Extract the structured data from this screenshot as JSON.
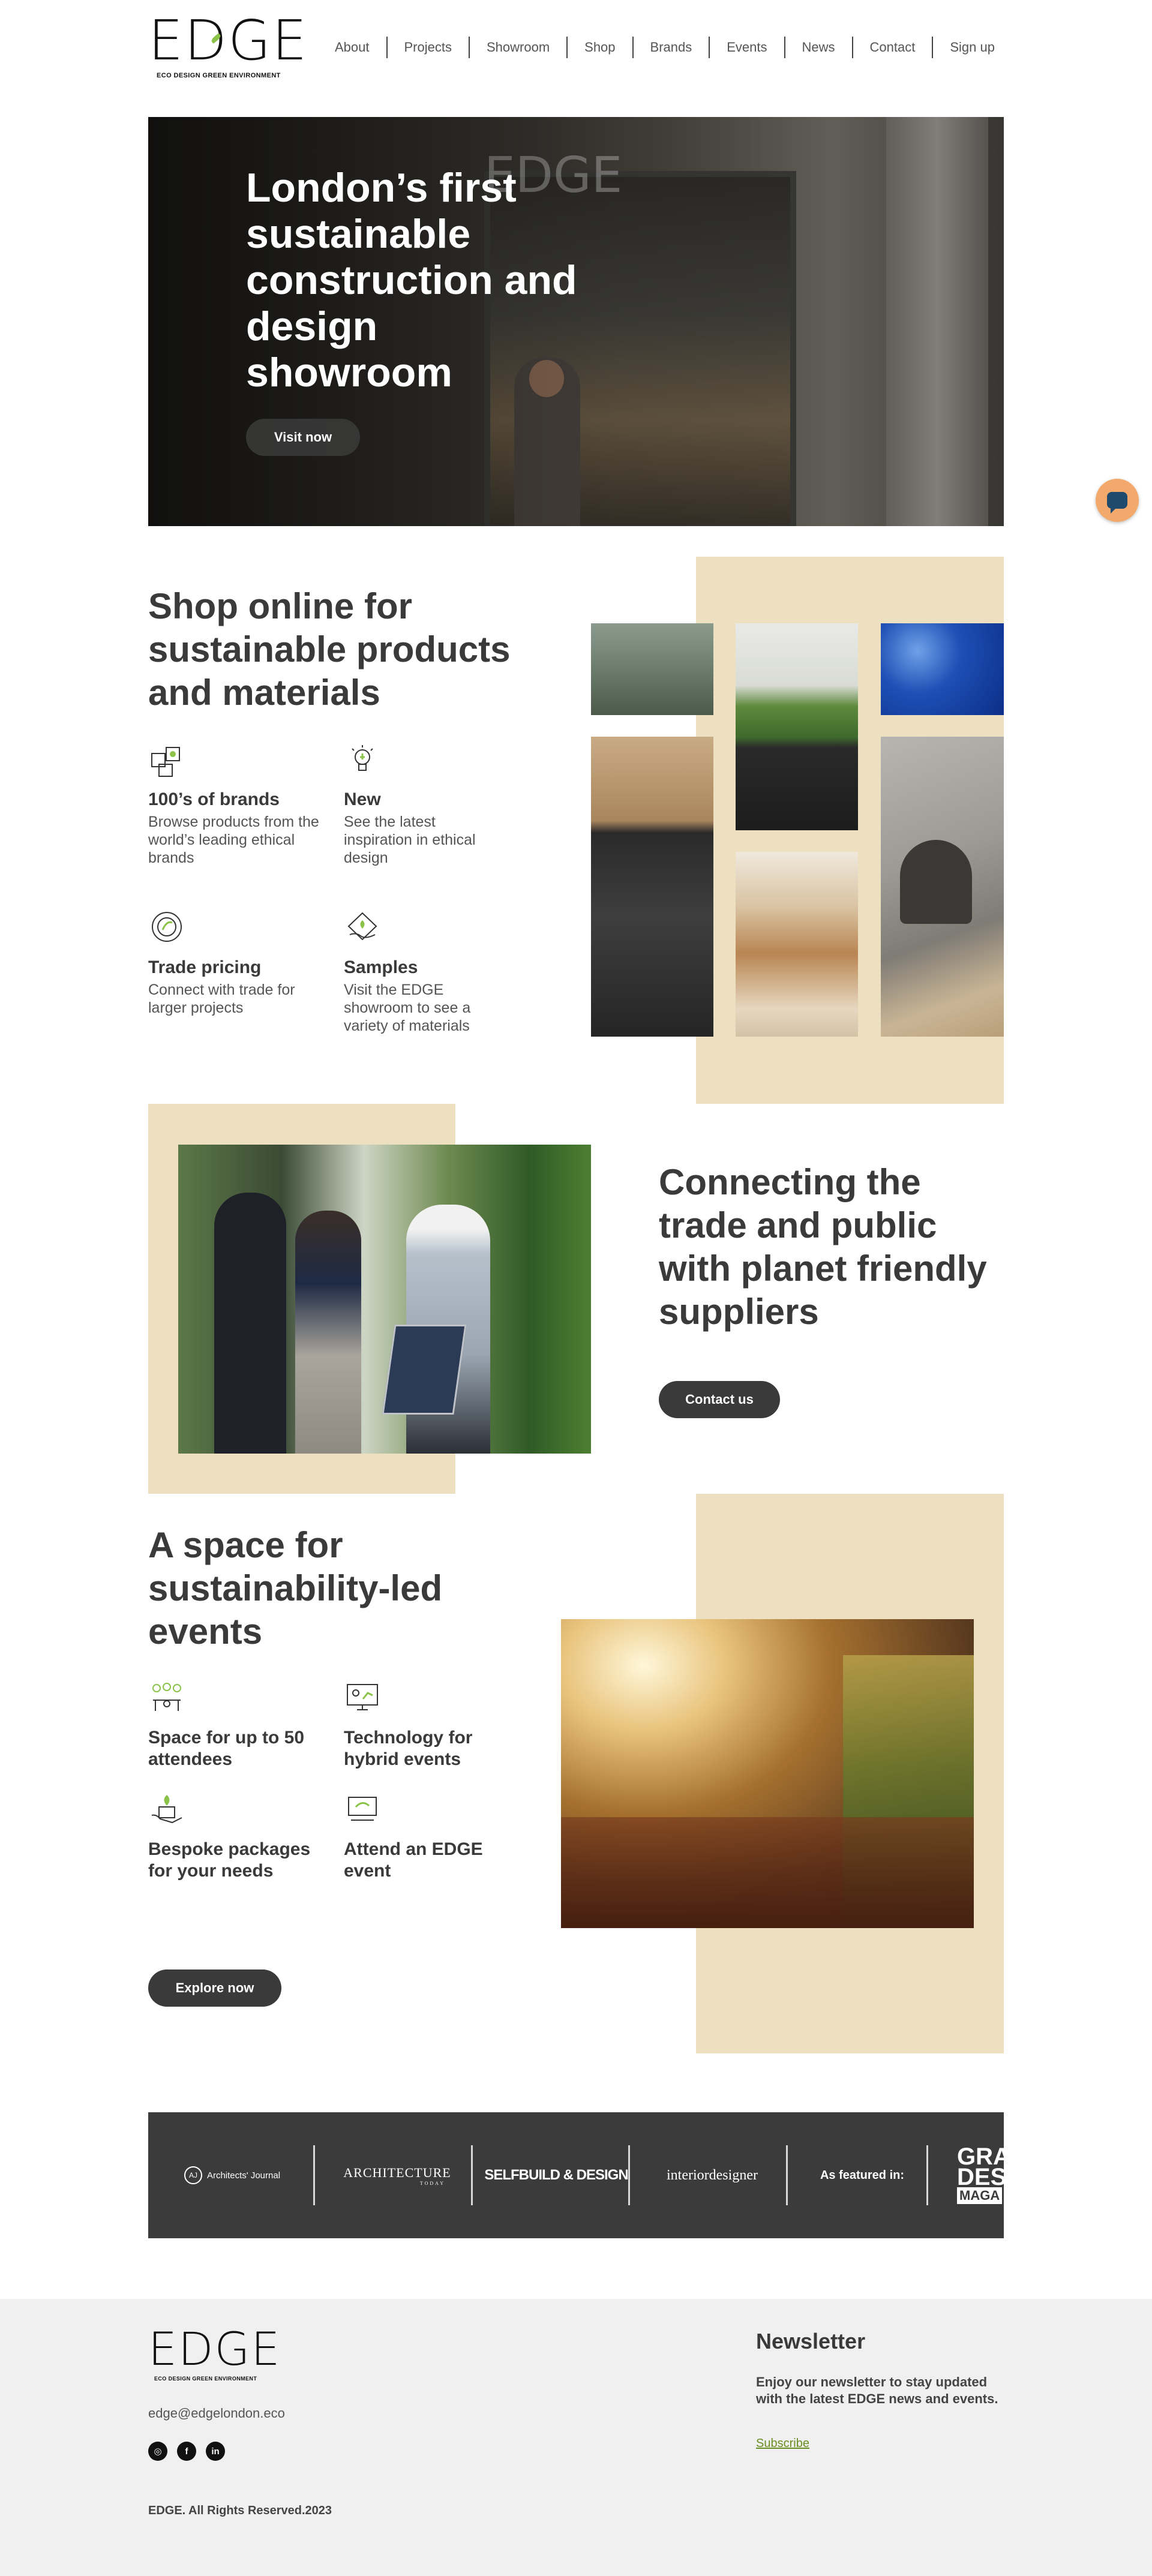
{
  "header": {
    "logo_text": "EDGE",
    "logo_tagline": "ECO DESIGN GREEN ENVIRONMENT",
    "nav": [
      "About",
      "Projects",
      "Showroom",
      "Shop",
      "Brands",
      "Events",
      "News",
      "Contact",
      "Sign up"
    ]
  },
  "hero": {
    "title": "London’s first sustainable construction and design showroom",
    "button": "Visit now"
  },
  "shop": {
    "title": "Shop online for sustainable products and materials",
    "features": [
      {
        "title": "100’s of brands",
        "text": "Browse products from the world’s leading ethical brands",
        "icon": "brands-icon"
      },
      {
        "title": "New",
        "text": "See the latest inspiration in ethical design",
        "icon": "lightbulb-icon"
      },
      {
        "title": "Trade pricing",
        "text": "Connect with trade for larger projects",
        "icon": "trade-pricing-icon"
      },
      {
        "title": "Samples",
        "text": "Visit the EDGE showroom to see a variety of materials",
        "icon": "samples-icon"
      }
    ]
  },
  "connect": {
    "title": "Connecting the trade and public with planet friendly suppliers",
    "button": "Contact us"
  },
  "events": {
    "title": "A space for sustainability-led events",
    "features": [
      {
        "title": "Space for up to 50 attendees",
        "icon": "attendees-icon"
      },
      {
        "title": "Technology for hybrid events",
        "icon": "technology-icon"
      },
      {
        "title": "Bespoke packages for your needs",
        "icon": "packages-icon"
      },
      {
        "title": "Attend an EDGE event",
        "icon": "event-icon"
      }
    ],
    "button": "Explore now"
  },
  "featured": {
    "label": "As featured in:",
    "logos": [
      "Architects' Journal",
      "ARCHITECTURE",
      "SELFBUILD & DESIGN",
      "interiordesigner",
      "GRAND DESIGNS MAGAZINE"
    ],
    "aj_mark": "AJ",
    "arch_sub": "TODAY",
    "grand_lines": [
      "GRA",
      "DESI",
      "MAGA"
    ]
  },
  "footer": {
    "email": "edge@edgelondon.eco",
    "social": [
      "instagram-icon",
      "facebook-icon",
      "linkedin-icon"
    ],
    "copyright": "EDGE. All Rights Reserved.2023",
    "newsletter_title": "Newsletter",
    "newsletter_text": "Enjoy our newsletter to stay updated with the latest EDGE news and events.",
    "newsletter_link": "Subscribe"
  },
  "colors": {
    "beige": "#ede0c0",
    "dark": "#3a3a3a",
    "chat": "#f3a96b",
    "link": "#6b8e23"
  }
}
